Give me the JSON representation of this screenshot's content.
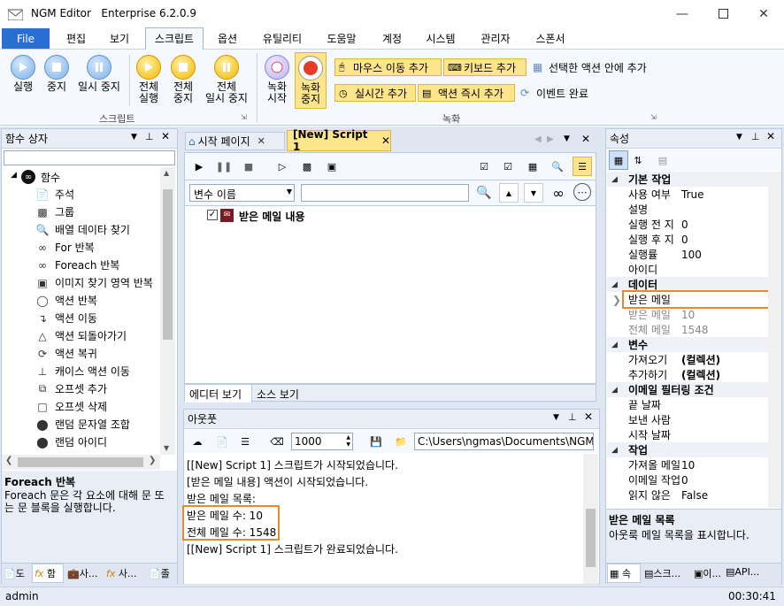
{
  "window": {
    "app_name": "NGM Editor",
    "edition": "Enterprise 6.2.0.9"
  },
  "menu": {
    "file": "File",
    "items": [
      "편집",
      "보기",
      "스크립트",
      "옵션",
      "유틸리티",
      "도움말",
      "계정",
      "시스템",
      "관리자",
      "스폰서"
    ]
  },
  "ribbon": {
    "script_group": {
      "run": "실행",
      "stop": "중지",
      "pause": "일시 중지",
      "run_all_1": "전체",
      "run_all_2": "실행",
      "stop_all_1": "전체",
      "stop_all_2": "중지",
      "pause_all_1": "전체",
      "pause_all_2": "일시 중지",
      "label": "스크립트"
    },
    "record_group": {
      "rec_start_1": "녹화",
      "rec_start_2": "시작",
      "rec_stop_1": "녹화",
      "rec_stop_2": "중지",
      "add_mouse": "마우스 이동 추가",
      "add_key": "키보드 추가",
      "add_in_action": "선택한 액션 안에 추가",
      "add_realtime": "실시간 추가",
      "add_action_now": "액션 즉시 추가",
      "event_done": "이벤트 완료",
      "label": "녹화"
    }
  },
  "left_panel": {
    "title": "함수 상자",
    "root": "함수",
    "items": [
      "주석",
      "그룹",
      "배열 데이타 찾기",
      "For 반복",
      "Foreach 반복",
      "이미지 찾기 영역 반복",
      "액션 반복",
      "액션 이동",
      "액션 되돌아가기",
      "액션 복귀",
      "캐이스 액션 이동",
      "오프셋 추가",
      "오프셋 삭제",
      "랜덤 문자열 조합",
      "랜덤 아이디"
    ],
    "desc_title": "Foreach 반복",
    "desc_text_1": "Foreach 문은 각 요소에 대해 문 또",
    "desc_text_2": "는 문 블록을 실행합니다.",
    "bottom_tabs": [
      "도",
      "함",
      "사...",
      "사...",
      "졸"
    ]
  },
  "editor": {
    "tab_start": "시작 페이지",
    "tab_script": "[New] Script 1",
    "var_dropdown": "변수 이름",
    "action_label": "받은 메일 내용",
    "bottom_tab_editor": "에디터 보기",
    "bottom_tab_source": "소스 보기"
  },
  "output": {
    "title": "아웃풋",
    "count": "1000",
    "path": "C:\\Users\\ngmas\\Documents\\NGM6\\",
    "lines": [
      "[[New] Script 1] 스크립트가 시작되었습니다.",
      "[받은 메일 내용] 액션이 시작되었습니다.",
      "받은 메일 목록:",
      "받은 메일 수: 10",
      "전체 메일 수: 1548",
      "[[New] Script 1] 스크립트가 완료되었습니다."
    ]
  },
  "properties": {
    "title": "속성",
    "cat_basic": "기본 작업",
    "use": {
      "name": "사용 여부",
      "value": "True"
    },
    "desc": {
      "name": "설명",
      "value": ""
    },
    "wait_before": {
      "name": "실행 전 지",
      "value": "0"
    },
    "wait_after": {
      "name": "실행 후 지",
      "value": "0"
    },
    "rate": {
      "name": "실행률",
      "value": "100"
    },
    "id": {
      "name": "아이디",
      "value": ""
    },
    "cat_data": "데이터",
    "received_mail": {
      "name": "받은 메일",
      "value": ""
    },
    "received_count": {
      "name": "받은 메일",
      "value": "10"
    },
    "total_count": {
      "name": "전체 메일",
      "value": "1548"
    },
    "cat_var": "변수",
    "get": {
      "name": "가져오기",
      "value": "(컬렉션)"
    },
    "add": {
      "name": "추가하기",
      "value": "(컬렉션)"
    },
    "cat_filter": "이메일 필터링 조건",
    "end_date": {
      "name": "끝 날짜",
      "value": ""
    },
    "sender": {
      "name": "보낸 사람",
      "value": ""
    },
    "start_date": {
      "name": "시작 날짜",
      "value": ""
    },
    "cat_work": "작업",
    "fetch": {
      "name": "가져올 메일",
      "value": "10"
    },
    "delete": {
      "name": "이메일 작업",
      "value": "0"
    },
    "unread": {
      "name": "읽지 않은",
      "value": "False"
    },
    "desc_title": "받은 메일 목록",
    "desc_text": "아웃룩 메일 목록을 표시합니다.",
    "bottom_tabs": [
      "속",
      "스크...",
      "이...",
      "API..."
    ]
  },
  "status": {
    "user": "admin",
    "time": "00:30:41"
  },
  "colors": {
    "accent": "#2b6ed2",
    "highlight": "#e8892a",
    "ribbon_bg": "#f5f8fc"
  }
}
